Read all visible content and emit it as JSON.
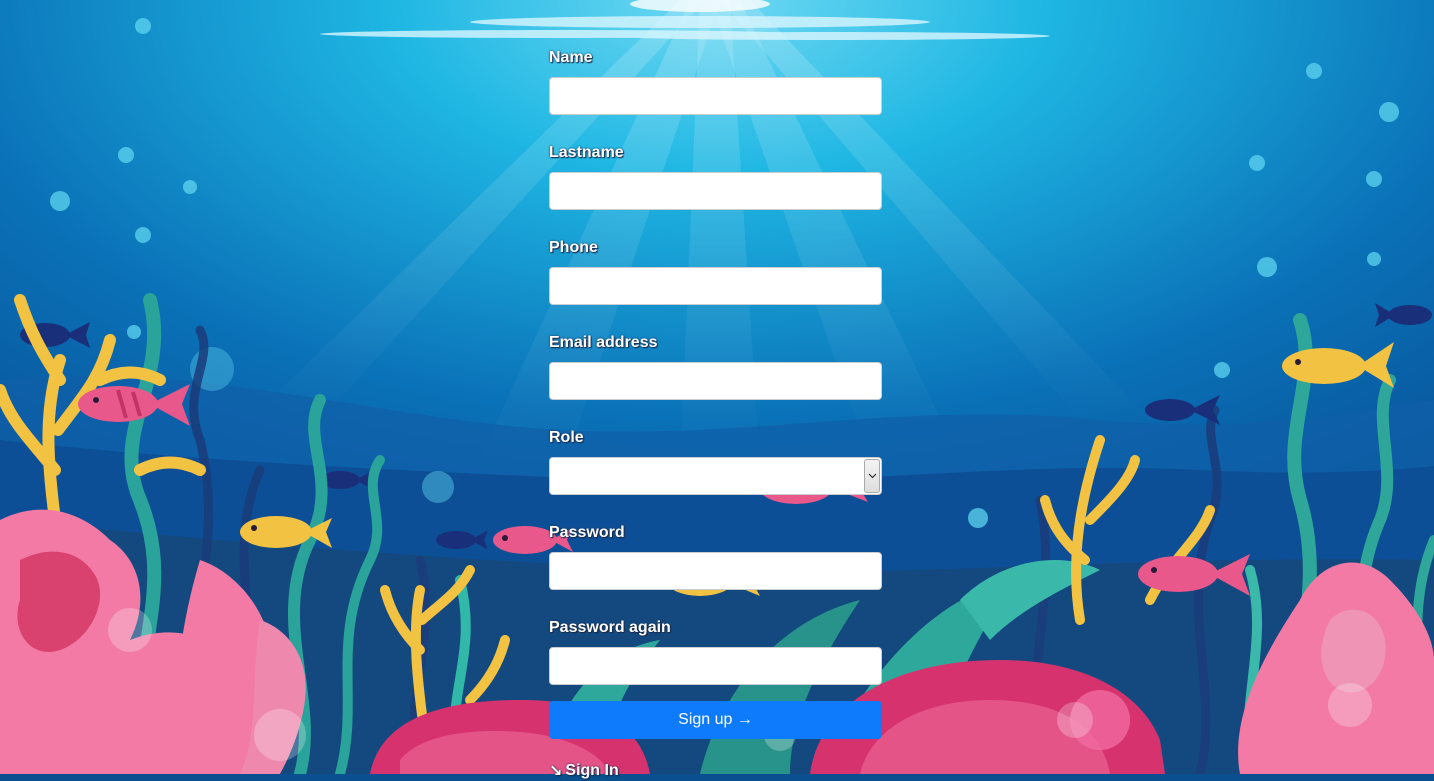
{
  "form": {
    "fields": [
      {
        "label": "Name",
        "value": "",
        "type": "text"
      },
      {
        "label": "Lastname",
        "value": "",
        "type": "text"
      },
      {
        "label": "Phone",
        "value": "",
        "type": "tel"
      },
      {
        "label": "Email address",
        "value": "",
        "type": "email"
      },
      {
        "label": "Role",
        "value": "",
        "type": "select"
      },
      {
        "label": "Password",
        "value": "",
        "type": "password"
      },
      {
        "label": "Password again",
        "value": "",
        "type": "password"
      }
    ],
    "submit_label": "Sign up →",
    "signin_icon": "↘",
    "signin_label": "Sign In"
  },
  "colors": {
    "submit_button": "#0d7bfb",
    "ocean_light": "#3cc4ea",
    "ocean_dark": "#0a3f82",
    "coral_pink": "#f27aa4",
    "coral_yellow": "#f7c84a",
    "seaweed_teal": "#2bb3a3"
  },
  "icons": {
    "select_arrow": "chevron-down-icon",
    "signin_arrow": "arrow-down-right-icon"
  }
}
